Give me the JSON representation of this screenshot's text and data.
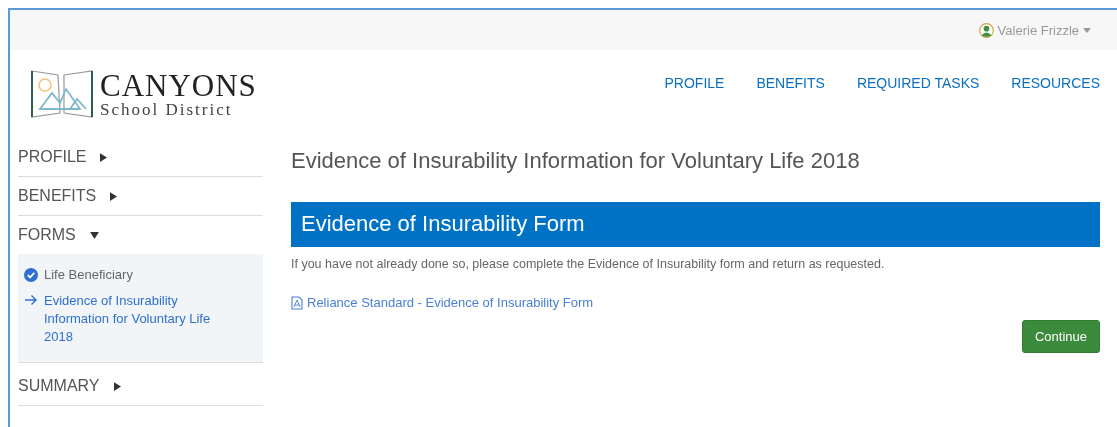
{
  "user": {
    "name": "Valerie Frizzle"
  },
  "logo": {
    "title": "CANYONS",
    "subtitle": "School District"
  },
  "nav": [
    {
      "label": "PROFILE"
    },
    {
      "label": "BENEFITS"
    },
    {
      "label": "REQUIRED TASKS"
    },
    {
      "label": "RESOURCES"
    }
  ],
  "sidebar": [
    {
      "label": "PROFILE",
      "expanded": false
    },
    {
      "label": "BENEFITS",
      "expanded": false
    },
    {
      "label": "FORMS",
      "expanded": true,
      "children": [
        {
          "label": "Life Beneficiary",
          "kind": "done"
        },
        {
          "label": "Evidence of Insurability Information for Voluntary Life 2018",
          "kind": "current"
        }
      ]
    },
    {
      "label": "SUMMARY",
      "expanded": false
    }
  ],
  "page_title": "Evidence of Insurability Information for Voluntary Life 2018",
  "panel": {
    "title": "Evidence of Insurability Form",
    "text": "If you have not already done so, please complete the Evidence of Insurability form and return as requested.",
    "link": "Reliance Standard - Evidence of Insurability Form"
  },
  "buttons": [
    {
      "label": "Continue"
    }
  ]
}
